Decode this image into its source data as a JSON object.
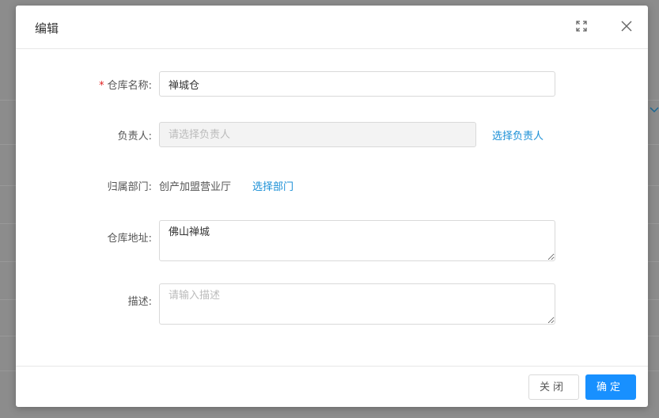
{
  "modal": {
    "title": "编辑"
  },
  "form": {
    "warehouse_name": {
      "label": "仓库名称",
      "required_mark": "*",
      "value": "禅城仓"
    },
    "owner": {
      "label": "负责人",
      "placeholder": "请选择负责人",
      "select_link": "选择负责人"
    },
    "department": {
      "label": "归属部门",
      "value": "创产加盟营业厅",
      "select_link": "选择部门"
    },
    "address": {
      "label": "仓库地址",
      "value": "佛山禅城"
    },
    "description": {
      "label": "描述",
      "placeholder": "请输入描述",
      "value": ""
    }
  },
  "footer": {
    "close_label": "关闭",
    "ok_label": "确定"
  },
  "colors": {
    "primary": "#1890ff",
    "link": "#1a8fd6",
    "required": "#e02020"
  },
  "icons": {
    "fullscreen": "fullscreen-icon",
    "close": "close-icon",
    "background_chevron": "chevron-down-icon"
  }
}
